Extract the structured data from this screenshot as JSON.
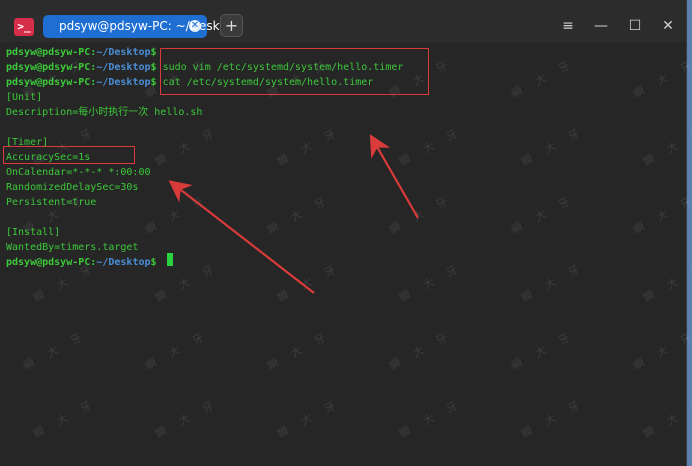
{
  "titlebar": {
    "tab_title": "pdsyw@pdsyw-PC: ~/Desktop",
    "tab_close_icon": "close-icon",
    "new_tab_label": "+",
    "app_icon_glyph": ">_",
    "menu_glyph": "≡",
    "minimize_glyph": "—",
    "maximize_glyph": "☐",
    "close_glyph": "✕"
  },
  "terminal": {
    "prompt_user": "pdsyw@pdsyw-PC",
    "prompt_path": "~/Desktop",
    "prompt_sep": ":",
    "prompt_end": "$",
    "cmd1": " sudo vim /etc/systemd/system/hello.timer",
    "cmd2": " cat /etc/systemd/system/hello.timer",
    "out": {
      "unit": "[Unit]",
      "description": "Description=每小时执行一次 hello.sh",
      "timer": "[Timer]",
      "accuracy": "AccuracySec=1s",
      "oncalendar": "OnCalendar=*-*-* *:00:00",
      "randomized": "RandomizedDelaySec=30s",
      "persistent": "Persistent=true",
      "install": "[Install]",
      "wantedby": "WantedBy=timers.target"
    }
  },
  "watermark": {
    "chars": [
      "瞬",
      "大",
      "牙"
    ]
  },
  "colors": {
    "background": "#262626",
    "text_green": "#3cc93a",
    "path_blue": "#4a8ed6",
    "tab_blue": "#1f6fd3",
    "annotation_red": "#d93a3a"
  }
}
